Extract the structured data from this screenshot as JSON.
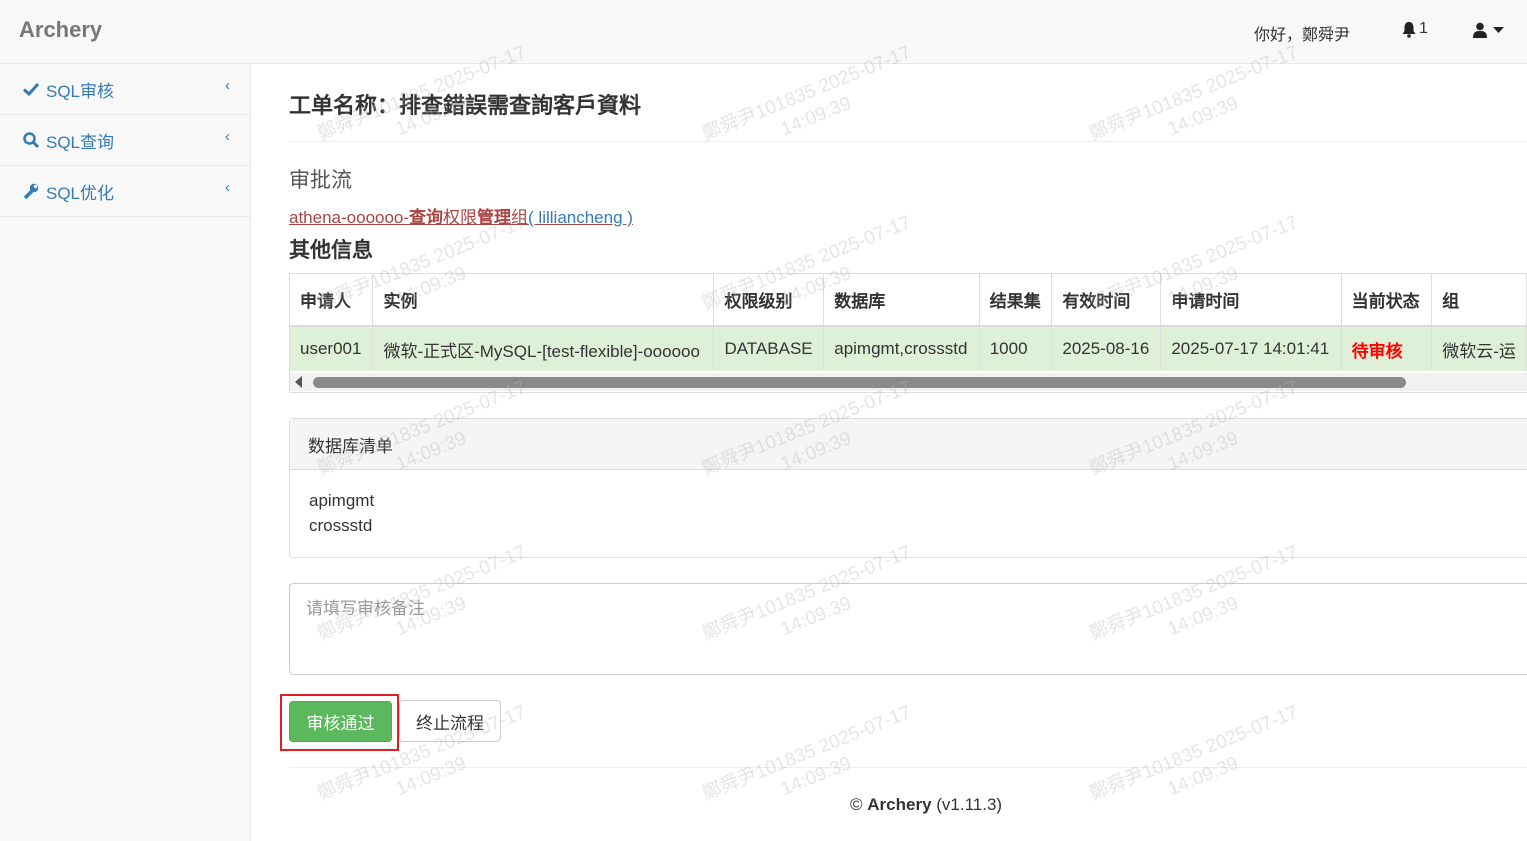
{
  "navbar": {
    "brand": "Archery",
    "greeting": "你好，鄭舜尹",
    "notification_count": "1"
  },
  "sidebar": {
    "items": [
      {
        "label": "SQL审核",
        "icon": "check-icon"
      },
      {
        "label": "SQL查询",
        "icon": "search-icon"
      },
      {
        "label": "SQL优化",
        "icon": "wrench-icon"
      }
    ]
  },
  "workflow": {
    "title": "工单名称：排查錯誤需查詢客戶資料",
    "approval_heading": "审批流",
    "approval_group_prefix": "athena-oooooo-",
    "approval_group_query": "查询",
    "approval_group_perm": "权限",
    "approval_group_mgmt": "管理",
    "approval_group_suffix": "组",
    "approval_user": "( lilliancheng )",
    "other_info_heading": "其他信息"
  },
  "table": {
    "headers": [
      "申请人",
      "实例",
      "权限级别",
      "数据库",
      "结果集",
      "有效时间",
      "申请时间",
      "当前状态",
      "组"
    ],
    "row": {
      "applicant": "user001",
      "instance": "微软-正式区-MySQL-[test-flexible]-oooooo",
      "priv_level": "DATABASE",
      "database": "apimgmt,crossstd",
      "result_limit": "1000",
      "valid_until": "2025-08-16",
      "apply_time": "2025-07-17 14:01:41",
      "status": "待审核",
      "group": "微软云-运"
    }
  },
  "db_panel": {
    "heading": "数据库清单",
    "databases": [
      "apimgmt",
      "crossstd"
    ]
  },
  "remark": {
    "placeholder": "请填写审核备注"
  },
  "actions": {
    "approve_label": "审核通过",
    "stop_label": "终止流程"
  },
  "footer": {
    "copyright": "©",
    "app": "Archery",
    "version": "(v1.11.3)"
  },
  "watermark": {
    "line1": "鄭舜尹101835 2025-07-17",
    "line2": "14:09:39"
  },
  "colors": {
    "link": "#337ab7",
    "approve": "#5cb85c",
    "status_pending": "#ff0000",
    "highlight_box": "#e02020",
    "row_success": "#dff0d8"
  }
}
